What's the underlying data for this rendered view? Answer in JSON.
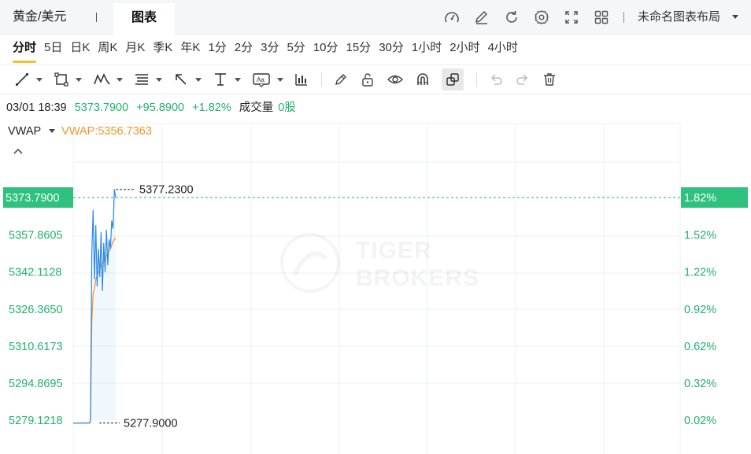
{
  "header": {
    "symbol_tab": "黄金/美元",
    "chart_tab": "图表",
    "layout_name": "未命名图表布局",
    "icons": [
      "gauge-icon",
      "edit-icon",
      "refresh-icon",
      "settings-icon",
      "fullscreen-icon",
      "grid-layout-icon"
    ]
  },
  "periods": [
    "分时",
    "5日",
    "日K",
    "周K",
    "月K",
    "季K",
    "年K",
    "1分",
    "2分",
    "3分",
    "5分",
    "10分",
    "15分",
    "30分",
    "1小时",
    "2小时",
    "4小时"
  ],
  "active_period": "分时",
  "toolbar": {
    "icons": [
      "line-tool-icon",
      "rectangle-tool-icon",
      "pattern-tool-icon",
      "fibonacci-tool-icon",
      "arrow-tool-icon",
      "measure-tool-icon",
      "text-tool-icon",
      "indicator-icon",
      "pencil-icon",
      "unlock-icon",
      "eye-icon",
      "magnet-icon",
      "link-icon",
      "undo-icon",
      "redo-icon",
      "trash-icon"
    ]
  },
  "info": {
    "time": "03/01 18:39",
    "price": "5373.7900",
    "change": "+95.8900",
    "change_pct": "+1.82%",
    "volume_label": "成交量",
    "volume": "0股"
  },
  "indicator": {
    "name": "VWAP",
    "value_text": "VWAP:5356.7363"
  },
  "colors": {
    "up": "#20b26c",
    "price_line": "#2b8ae8",
    "vwap_line": "#f0962e",
    "highlight": "#f2c12e"
  },
  "watermark": [
    "TIGER",
    "BROKERS"
  ],
  "chart_data": {
    "type": "line",
    "y_labels": [
      "5373.7900",
      "5357.8605",
      "5342.1128",
      "5326.3650",
      "5310.6173",
      "5294.8695",
      "5279.1218"
    ],
    "y_ticks": [
      5373.79,
      5357.8605,
      5342.1128,
      5326.365,
      5310.6173,
      5294.8695,
      5279.1218
    ],
    "right_labels": [
      "1.82%",
      "1.52%",
      "1.22%",
      "0.92%",
      "0.62%",
      "0.32%",
      "0.02%"
    ],
    "current_price": 5373.79,
    "current_label": "5373.7900",
    "current_pct_label": "1.82%",
    "high_label": "5377.2300",
    "high": 5377.23,
    "low_label": "5277.9000",
    "low": 5277.9,
    "ylim": [
      5277.9,
      5377.23
    ],
    "series": [
      {
        "name": "price",
        "values": [
          5277.9,
          5277.9,
          5277.9,
          5277.9,
          5277.9,
          5277.9,
          5277.9,
          5277.9,
          5277.9,
          5277.9,
          5277.9,
          5277.9,
          5277.9,
          5278.2,
          5350.0,
          5368.5,
          5339.0,
          5362.0,
          5336.0,
          5352.0,
          5340.0,
          5359.0,
          5334.0,
          5354.5,
          5342.0,
          5360.0,
          5345.0,
          5356.0,
          5352.0,
          5364.0,
          5360.5,
          5377.23,
          5373.79
        ]
      },
      {
        "name": "vwap",
        "values": [
          5277.9,
          5277.9,
          5277.9,
          5277.9,
          5277.9,
          5277.9,
          5277.9,
          5277.9,
          5277.9,
          5277.9,
          5277.9,
          5277.9,
          5277.9,
          5278.5,
          5321.0,
          5333.0,
          5335.0,
          5339.0,
          5340.5,
          5342.0,
          5343.0,
          5345.0,
          5346.0,
          5347.0,
          5348.0,
          5349.0,
          5350.0,
          5351.0,
          5352.0,
          5353.5,
          5355.0,
          5356.0,
          5356.7363
        ]
      }
    ]
  }
}
